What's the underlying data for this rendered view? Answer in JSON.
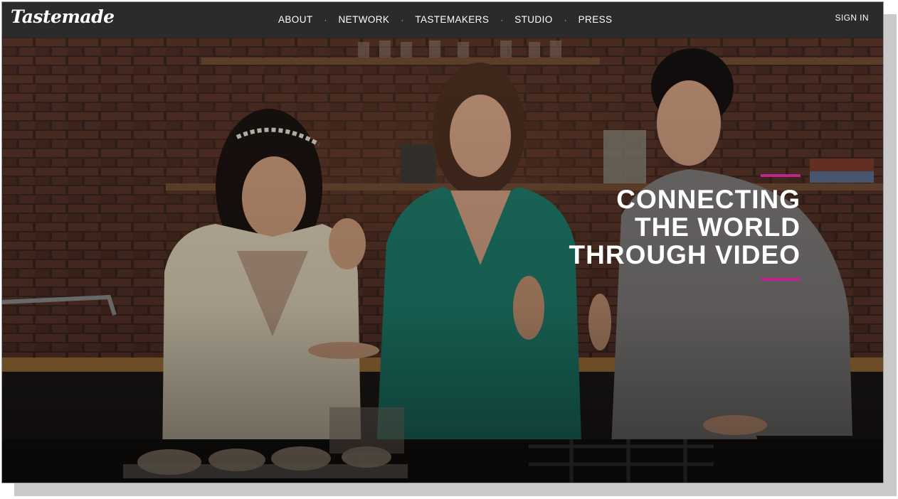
{
  "brand": {
    "logo_text": "Tastemade"
  },
  "nav": {
    "items": [
      {
        "label": "ABOUT"
      },
      {
        "label": "NETWORK"
      },
      {
        "label": "TASTEMAKERS"
      },
      {
        "label": "STUDIO"
      },
      {
        "label": "PRESS"
      }
    ],
    "separator": "·",
    "sign_in_label": "SIGN IN"
  },
  "hero": {
    "tagline_lines": [
      "CONNECTING",
      "THE WORLD",
      "THROUGH VIDEO"
    ],
    "accent_color": "#c2228f"
  },
  "colors": {
    "navbar_bg": "#2b2b2b",
    "nav_text": "#ffffff"
  }
}
